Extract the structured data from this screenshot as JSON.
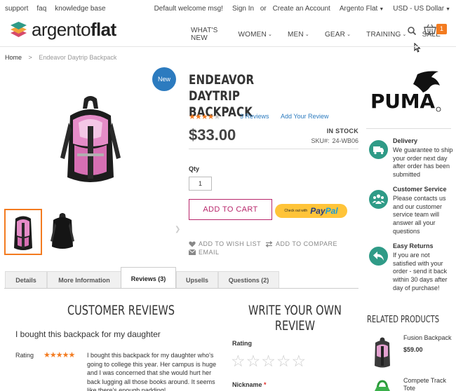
{
  "topbar": {
    "links_left": [
      "support",
      "faq",
      "knowledge base"
    ],
    "welcome": "Default welcome msg!",
    "sign_in": "Sign In",
    "or": "or",
    "create_account": "Create an Account",
    "store": "Argento Flat",
    "currency": "USD - US Dollar"
  },
  "header": {
    "logo_part1": "argento",
    "logo_part2": "flat",
    "nav": [
      "WHAT'S NEW",
      "WOMEN",
      "MEN",
      "GEAR",
      "TRAINING",
      "SALE"
    ],
    "nav_has_dropdown": [
      false,
      true,
      true,
      true,
      true,
      false
    ],
    "cart_count": "1"
  },
  "breadcrumb": {
    "home": "Home",
    "separator": ">",
    "current": "Endeavor Daytrip Backpack"
  },
  "gallery": {
    "badge": "New"
  },
  "product": {
    "title": "ENDEAVOR DAYTRIP BACKPACK",
    "rating_percent": 80,
    "reviews_link": "3 Reviews",
    "add_review": "Add Your Review",
    "price": "$33.00",
    "stock": "IN STOCK",
    "sku_label": "SKU#:",
    "sku": "24-WB06",
    "qty_label": "Qty",
    "qty_value": "1",
    "add_to_cart": "ADD TO CART",
    "paypal_small": "Check out with",
    "paypal_p1": "Pay",
    "paypal_p2": "Pal",
    "wishlist": "ADD TO WISH LIST",
    "compare": "ADD TO COMPARE",
    "email": "EMAIL"
  },
  "tabs": [
    {
      "label": "Details",
      "active": false
    },
    {
      "label": "More Information",
      "active": false
    },
    {
      "label": "Reviews (3)",
      "active": true
    },
    {
      "label": "Upsells",
      "active": false
    },
    {
      "label": "Questions (2)",
      "active": false
    }
  ],
  "reviews": {
    "title": "CUSTOMER REVIEWS",
    "review_title": "I bought this backpack for my daughter",
    "rating_label": "Rating",
    "rating_stars": 5,
    "body": "I bought this backpack for my daughter who's going to college this year. Her campus is huge and I was concerned that she would hurt her back lugging all those books around. It seems like there's enough padding!"
  },
  "write_review": {
    "title_line1": "WRITE YOUR OWN",
    "title_line2": "REVIEW",
    "rating_label": "Rating",
    "nickname_label": "Nickname",
    "required_mark": "*"
  },
  "sidebar": {
    "brand": "PUMA",
    "features": [
      {
        "icon": "truck-icon",
        "title": "Delivery",
        "text": "We guarantee to ship your order next day after order has been submitted"
      },
      {
        "icon": "users-icon",
        "title": "Customer Service",
        "text": "Please contacts us and our customer service team will answer all your questions"
      },
      {
        "icon": "return-icon",
        "title": "Easy Returns",
        "text": "If you are not satisfied with your order - send it back within 30 days after day of purchase!"
      }
    ],
    "related_title": "RELATED PRODUCTS",
    "related": [
      {
        "name": "Fusion Backpack",
        "price": "$59.00"
      },
      {
        "name": "Compete Track Tote",
        "price": ""
      }
    ]
  },
  "colors": {
    "accent": "#f37b20",
    "link": "#2c7bbf",
    "cart_button": "#b8266b",
    "feature_icon": "#2f9b87",
    "paypal": "#ffc439"
  }
}
